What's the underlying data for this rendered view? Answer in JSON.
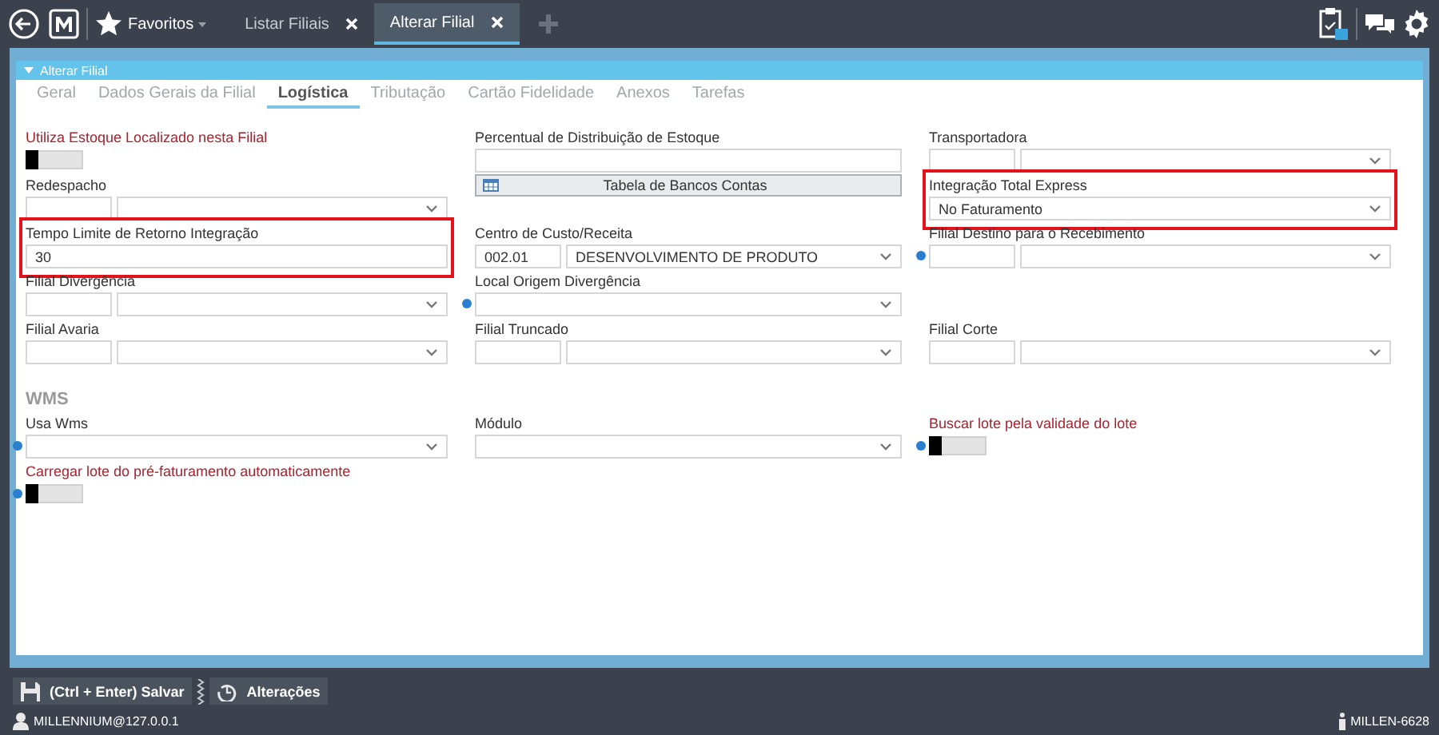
{
  "topbar": {
    "favorites": "Favoritos",
    "tabs": [
      {
        "label": "Listar Filiais",
        "selected": false
      },
      {
        "label": "Alterar Filial",
        "selected": true
      }
    ]
  },
  "panel": {
    "title": "Alterar Filial",
    "expanded": true,
    "tabs": [
      {
        "label": "Geral",
        "selected": false
      },
      {
        "label": "Dados Gerais da Filial",
        "selected": false
      },
      {
        "label": "Logística",
        "selected": true
      },
      {
        "label": "Tributação",
        "selected": false
      },
      {
        "label": "Cartão Fidelidade",
        "selected": false
      },
      {
        "label": "Anexos",
        "selected": false
      },
      {
        "label": "Tarefas",
        "selected": false
      }
    ]
  },
  "form_rows": [
    [
      {
        "kind": "toggle",
        "label": "Utiliza Estoque Localizado nesta Filial",
        "emphasized": true,
        "on": false
      },
      {
        "kind": "input",
        "label": "Percentual de Distribuição de Estoque"
      },
      {
        "kind": "code-select",
        "label": "Transportadora"
      }
    ],
    [
      {
        "kind": "code-select",
        "label": "Redespacho"
      },
      {
        "kind": "button",
        "label": "Tabela de Bancos Contas"
      },
      {
        "kind": "select",
        "label": "Integração Total Express",
        "value": "No Faturamento",
        "highlighted": true
      }
    ],
    [
      {
        "kind": "input",
        "label": "Tempo Limite de Retorno Integração",
        "value": "30",
        "highlighted": true
      },
      {
        "kind": "code-select",
        "label": "Centro de Custo/Receita",
        "code": "002.01",
        "value": "DESENVOLVIMENTO DE PRODUTO"
      },
      {
        "kind": "code-select",
        "label": "Filial Destino para o Recebimento",
        "help": true
      }
    ],
    [
      {
        "kind": "code-select",
        "label": "Filial Divergência"
      },
      {
        "kind": "select",
        "label": "Local Origem Divergência",
        "help": true
      }
    ],
    [
      {
        "kind": "code-select",
        "label": "Filial Avaria"
      },
      {
        "kind": "code-select",
        "label": "Filial Truncado"
      },
      {
        "kind": "code-select",
        "label": "Filial Corte"
      }
    ]
  ],
  "wms": {
    "title": "WMS",
    "rows": [
      [
        {
          "kind": "select",
          "label": "Usa Wms",
          "help": true
        },
        {
          "kind": "select",
          "label": "Módulo"
        },
        {
          "kind": "toggle",
          "label": "Buscar lote pela validade do lote",
          "emphasized": true,
          "help": true,
          "on": false
        }
      ],
      [
        {
          "kind": "toggle",
          "label": "Carregar lote do pré-faturamento automaticamente",
          "emphasized": true,
          "help": true,
          "on": false
        }
      ]
    ]
  },
  "footer": {
    "buttons": [
      {
        "label": "(Ctrl + Enter) Salvar",
        "kind": "save"
      },
      {
        "label": "Alterações",
        "kind": "history"
      }
    ]
  },
  "status_bar": {
    "user": "MILLENNIUM@127.0.0.1",
    "machine": "MILLEN-6628"
  }
}
